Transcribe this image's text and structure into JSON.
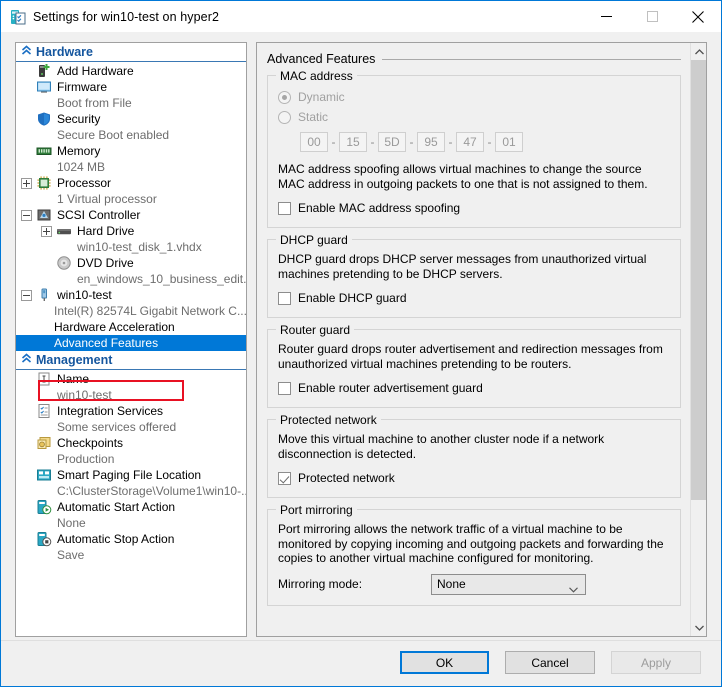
{
  "window": {
    "title": "Settings for win10-test on hyper2",
    "icon": "vm-settings-icon",
    "minimize_label": "—",
    "maximize_label": "□",
    "close_label": "✕"
  },
  "sidebar": {
    "sections": [
      {
        "name": "Hardware",
        "label": "Hardware",
        "items": [
          {
            "label": "Add Hardware",
            "sub": "",
            "icon": "add-hardware-icon",
            "expander": "none",
            "indent": 0,
            "selected": false
          },
          {
            "label": "Firmware",
            "sub": "Boot from File",
            "icon": "firmware-icon",
            "expander": "none",
            "indent": 0,
            "selected": false
          },
          {
            "label": "Security",
            "sub": "Secure Boot enabled",
            "icon": "security-shield-icon",
            "expander": "none",
            "indent": 0,
            "selected": false
          },
          {
            "label": "Memory",
            "sub": "1024 MB",
            "icon": "memory-icon",
            "expander": "none",
            "indent": 0,
            "selected": false
          },
          {
            "label": "Processor",
            "sub": "1 Virtual processor",
            "icon": "processor-icon",
            "expander": "plus",
            "indent": 0,
            "selected": false
          },
          {
            "label": "SCSI Controller",
            "sub": "",
            "icon": "scsi-controller-icon",
            "expander": "minus",
            "indent": 0,
            "selected": false
          },
          {
            "label": "Hard Drive",
            "sub": "win10-test_disk_1.vhdx",
            "icon": "hard-drive-icon",
            "expander": "plus",
            "indent": 1,
            "selected": false
          },
          {
            "label": "DVD Drive",
            "sub": "en_windows_10_business_edit...",
            "icon": "dvd-drive-icon",
            "expander": "none",
            "indent": 1,
            "selected": false
          },
          {
            "label": "win10-test",
            "sub": "Intel(R) 82574L Gigabit Network C...",
            "icon": "network-adapter-icon",
            "expander": "minus",
            "indent": 0,
            "selected": false
          },
          {
            "label": "Hardware Acceleration",
            "sub": "",
            "icon": "none",
            "expander": "none",
            "indent": 2,
            "selected": false
          },
          {
            "label": "Advanced Features",
            "sub": "",
            "icon": "none",
            "expander": "none",
            "indent": 2,
            "selected": true
          }
        ]
      },
      {
        "name": "Management",
        "label": "Management",
        "items": [
          {
            "label": "Name",
            "sub": "win10-test",
            "icon": "name-icon",
            "expander": "none",
            "indent": 0,
            "selected": false
          },
          {
            "label": "Integration Services",
            "sub": "Some services offered",
            "icon": "integration-services-icon",
            "expander": "none",
            "indent": 0,
            "selected": false
          },
          {
            "label": "Checkpoints",
            "sub": "Production",
            "icon": "checkpoints-icon",
            "expander": "none",
            "indent": 0,
            "selected": false
          },
          {
            "label": "Smart Paging File Location",
            "sub": "C:\\ClusterStorage\\Volume1\\win10-...",
            "icon": "smart-paging-icon",
            "expander": "none",
            "indent": 0,
            "selected": false
          },
          {
            "label": "Automatic Start Action",
            "sub": "None",
            "icon": "auto-start-icon",
            "expander": "none",
            "indent": 0,
            "selected": false
          },
          {
            "label": "Automatic Stop Action",
            "sub": "Save",
            "icon": "auto-stop-icon",
            "expander": "none",
            "indent": 0,
            "selected": false
          }
        ]
      }
    ]
  },
  "content": {
    "heading": "Advanced Features",
    "mac_address": {
      "title": "MAC address",
      "dynamic_label": "Dynamic",
      "static_label": "Static",
      "selected": "Dynamic",
      "octets": [
        "00",
        "15",
        "5D",
        "95",
        "47",
        "01"
      ],
      "separator": "-",
      "spoofing_description": "MAC address spoofing allows virtual machines to change the source MAC address in outgoing packets to one that is not assigned to them.",
      "spoofing_checkbox_label": "Enable MAC address spoofing",
      "spoofing_checked": false
    },
    "dhcp_guard": {
      "title": "DHCP guard",
      "description": "DHCP guard drops DHCP server messages from unauthorized virtual machines pretending to be DHCP servers.",
      "checkbox_label": "Enable DHCP guard",
      "checked": false
    },
    "router_guard": {
      "title": "Router guard",
      "description": "Router guard drops router advertisement and redirection messages from unauthorized virtual machines pretending to be routers.",
      "checkbox_label": "Enable router advertisement guard",
      "checked": false
    },
    "protected_network": {
      "title": "Protected network",
      "description": "Move this virtual machine to another cluster node if a network disconnection is detected.",
      "checkbox_label": "Protected network",
      "checked": true
    },
    "port_mirroring": {
      "title": "Port mirroring",
      "description": "Port mirroring allows the network traffic of a virtual machine to be monitored by copying incoming and outgoing packets and forwarding the copies to another virtual machine configured for monitoring.",
      "mode_label": "Mirroring mode:",
      "mode_value": "None"
    }
  },
  "footer": {
    "ok": "OK",
    "cancel": "Cancel",
    "apply": "Apply"
  },
  "colors": {
    "accent": "#0078d7",
    "selection": "#0078d7",
    "annotation": "#e81123",
    "section_header": "#15569e",
    "subtext": "#6d6d6d"
  }
}
